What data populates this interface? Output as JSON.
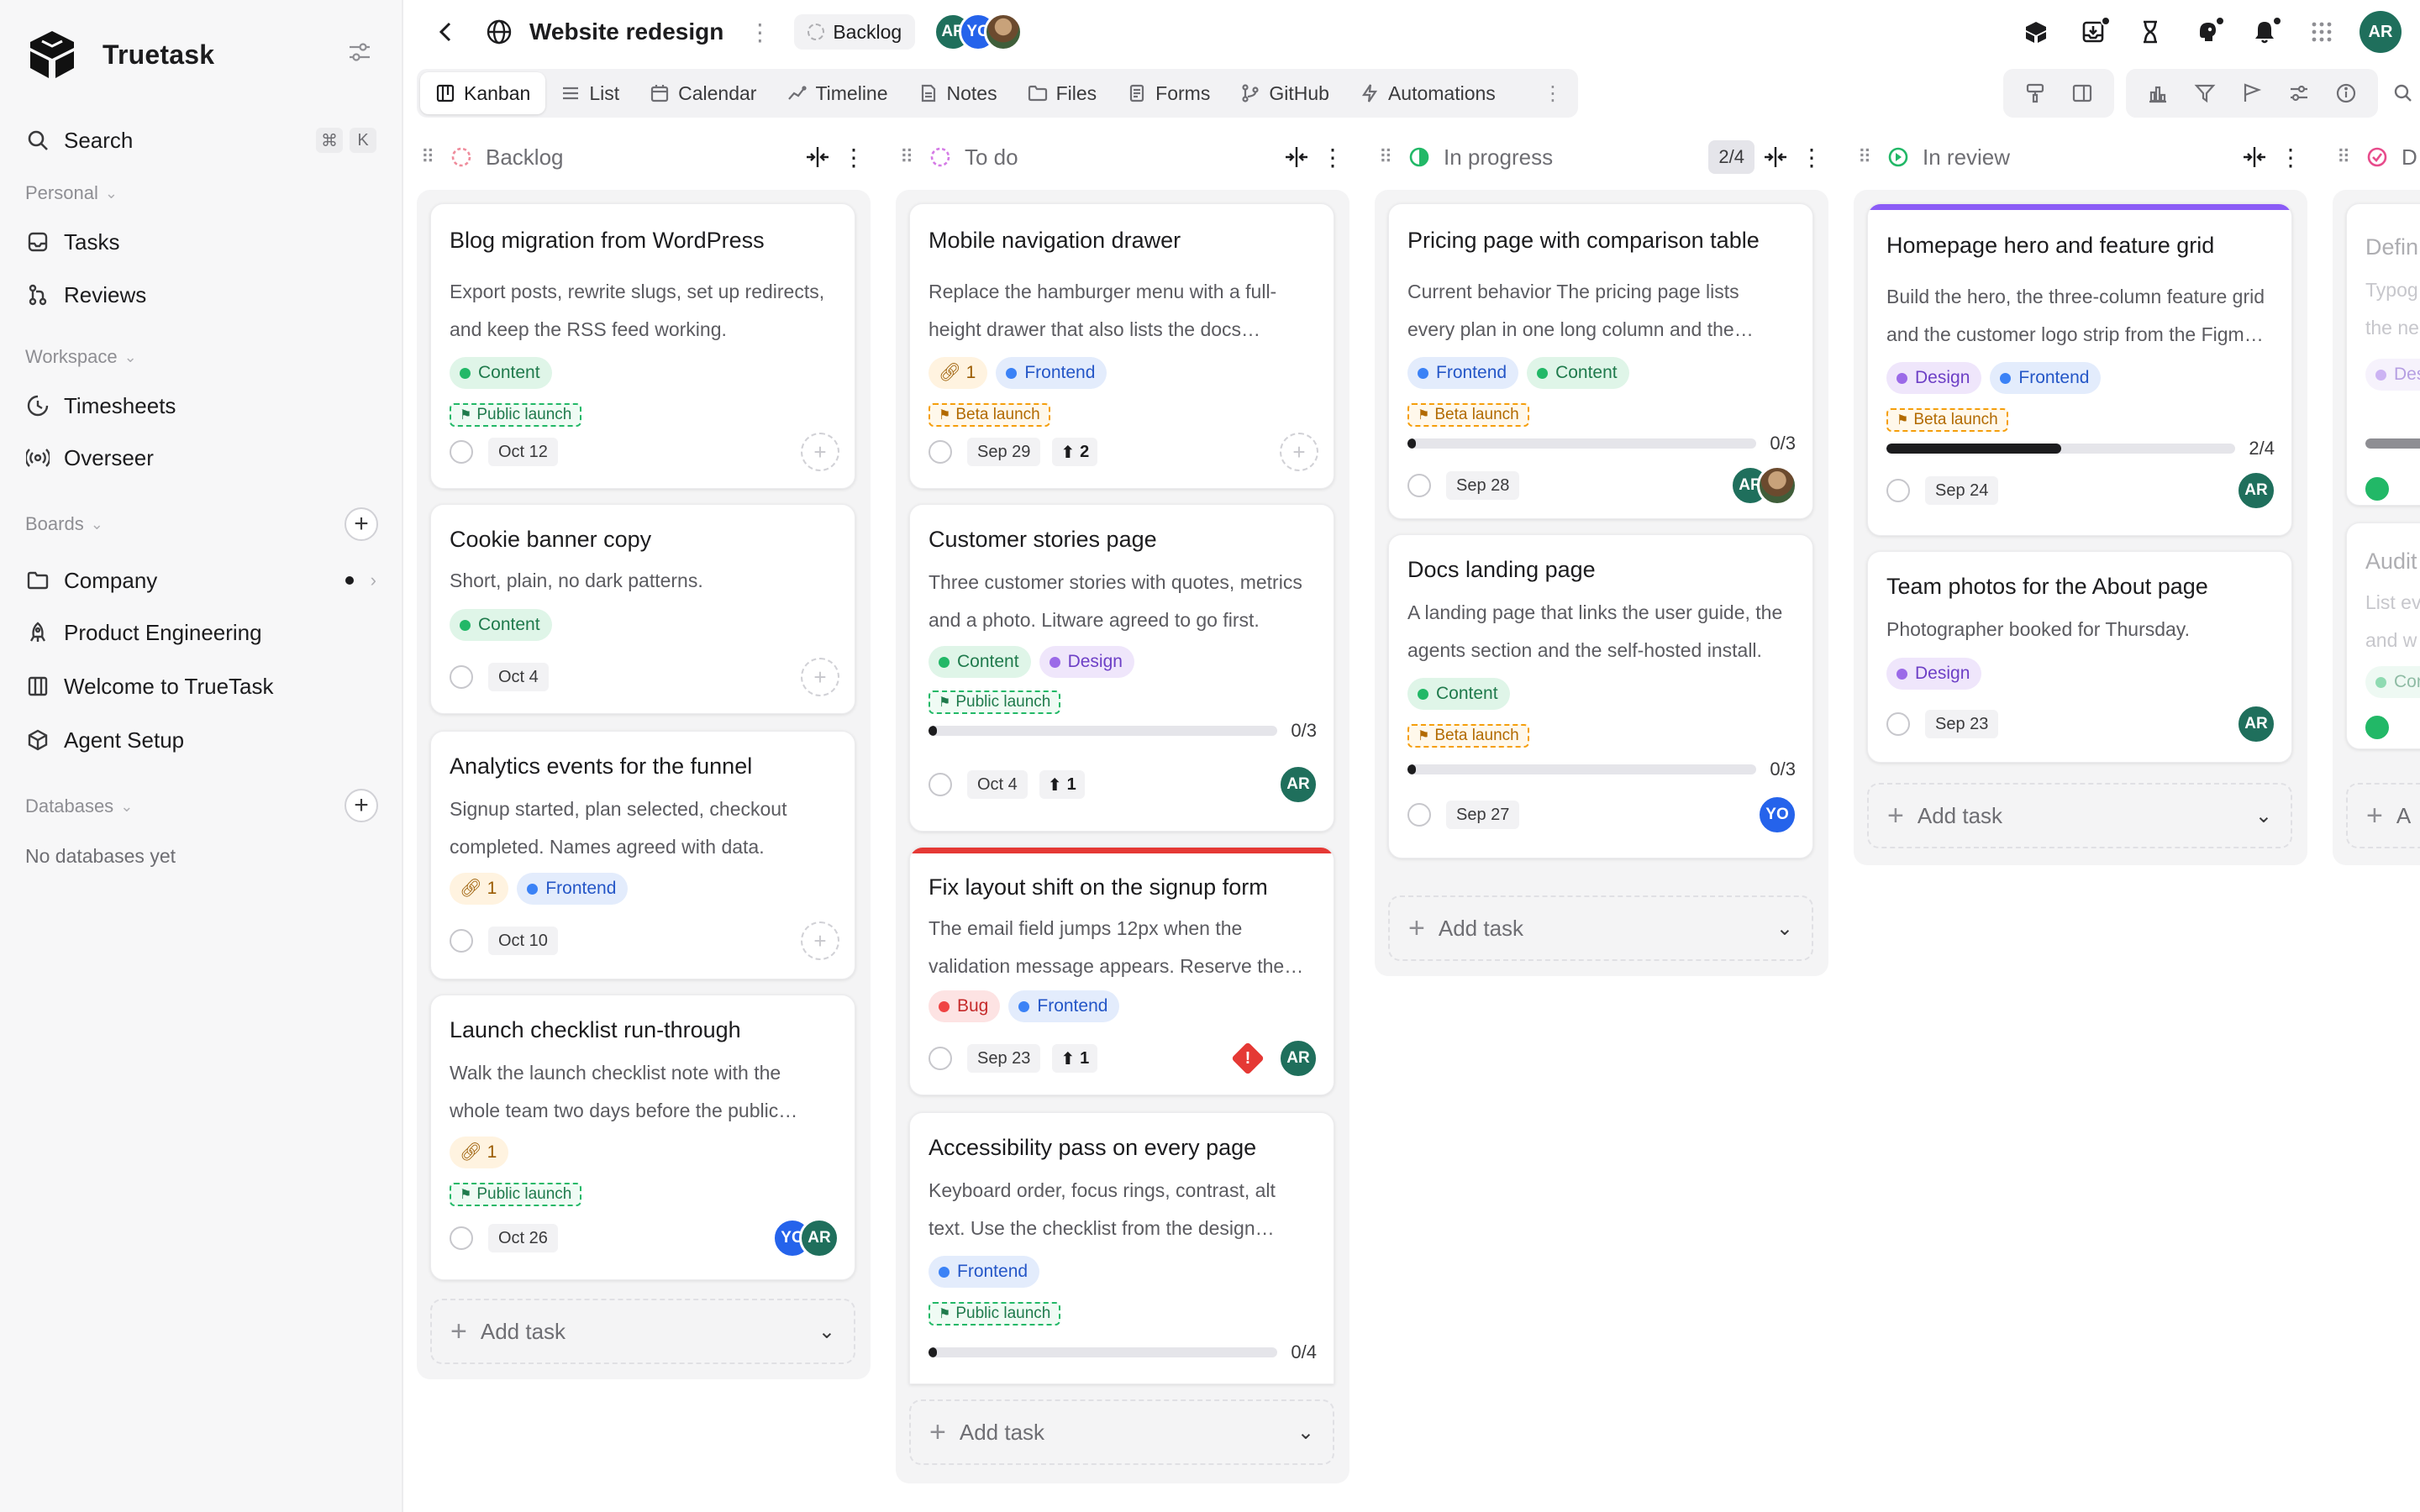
{
  "app": {
    "name": "Truetask"
  },
  "sidebar": {
    "search": {
      "label": "Search",
      "keys": [
        "⌘",
        "K"
      ]
    },
    "personal": {
      "label": "Personal",
      "items": [
        {
          "label": "Tasks"
        },
        {
          "label": "Reviews"
        }
      ]
    },
    "workspace": {
      "label": "Workspace",
      "items": [
        {
          "label": "Timesheets"
        },
        {
          "label": "Overseer"
        }
      ]
    },
    "boards": {
      "label": "Boards",
      "items": [
        {
          "label": "Company"
        },
        {
          "label": "Product Engineering"
        },
        {
          "label": "Welcome to TrueTask"
        },
        {
          "label": "Agent Setup"
        }
      ]
    },
    "databases": {
      "label": "Databases",
      "empty": "No databases yet"
    }
  },
  "header": {
    "title": "Website redesign",
    "status": "Backlog",
    "members": [
      "AR",
      "YO"
    ],
    "user_initials": "AR"
  },
  "tabs": [
    {
      "label": "Kanban",
      "active": true
    },
    {
      "label": "List"
    },
    {
      "label": "Calendar"
    },
    {
      "label": "Timeline"
    },
    {
      "label": "Notes"
    },
    {
      "label": "Files"
    },
    {
      "label": "Forms"
    },
    {
      "label": "GitHub"
    },
    {
      "label": "Automations"
    }
  ],
  "columns": [
    {
      "name": "Backlog",
      "add_label": "Add task",
      "cards": [
        {
          "title": "Blog migration from WordPress",
          "desc": "Export posts, rewrite slugs, set up redirects, and keep the RSS feed working.",
          "tags": [
            "Content"
          ],
          "milestone": "Public launch",
          "date": "Oct 12"
        },
        {
          "title": "Cookie banner copy",
          "desc": "Short, plain, no dark patterns.",
          "tags": [
            "Content"
          ],
          "date": "Oct 4"
        },
        {
          "title": "Analytics events for the funnel",
          "desc": "Signup started, plan selected, checkout completed. Names agreed with data.",
          "links": "1",
          "tags": [
            "Frontend"
          ],
          "date": "Oct 10"
        },
        {
          "title": "Launch checklist run-through",
          "desc": "Walk the launch checklist note with the whole team two days before the public launch.",
          "links": "1",
          "milestone": "Public launch",
          "date": "Oct 26",
          "assignees": [
            "YO",
            "AR"
          ]
        }
      ]
    },
    {
      "name": "To do",
      "add_label": "Add task",
      "cards": [
        {
          "title": "Mobile navigation drawer",
          "desc": "Replace the hamburger menu with a full-height drawer that also lists the docs sections.",
          "links": "1",
          "tags": [
            "Frontend"
          ],
          "milestone": "Beta launch",
          "date": "Sep 29",
          "priority": "2"
        },
        {
          "title": "Customer stories page",
          "desc": "Three customer stories with quotes, metrics and a photo. Litware agreed to go first.",
          "tags": [
            "Content",
            "Design"
          ],
          "milestone": "Public launch",
          "progress": "0/3",
          "progress_fraction": 0.0,
          "date": "Oct 4",
          "priority": "1",
          "assignees": [
            "AR"
          ]
        },
        {
          "title": "Fix layout shift on the signup form",
          "desc": "The email field jumps 12px when the validation message appears. Reserve the space.",
          "tags": [
            "Bug",
            "Frontend"
          ],
          "date": "Sep 23",
          "priority": "1",
          "urgent": "!",
          "assignees": [
            "AR"
          ],
          "accent": "#e53935"
        },
        {
          "title": "Accessibility pass on every page",
          "desc": "Keyboard order, focus rings, contrast, alt text. Use the checklist from the design system.",
          "tags": [
            "Frontend"
          ],
          "milestone": "Public launch",
          "progress": "0/4",
          "progress_fraction": 0.0
        }
      ]
    },
    {
      "name": "In progress",
      "count": "2/4",
      "add_label": "Add task",
      "cards": [
        {
          "title": "Pricing page with comparison table",
          "desc": "Current behavior The pricing page lists every plan in one long column and the comparison is hard to read.",
          "tags": [
            "Frontend",
            "Content"
          ],
          "milestone": "Beta launch",
          "progress": "0/3",
          "progress_fraction": 0.0,
          "date": "Sep 28",
          "assignees": [
            "AR",
            "photo"
          ]
        },
        {
          "title": "Docs landing page",
          "desc": "A landing page that links the user guide, the agents section and the self-hosted install.",
          "tags": [
            "Content"
          ],
          "milestone": "Beta launch",
          "progress": "0/3",
          "progress_fraction": 0.0,
          "date": "Sep 27",
          "assignees": [
            "YO"
          ]
        }
      ]
    },
    {
      "name": "In review",
      "add_label": "Add task",
      "cards": [
        {
          "title": "Homepage hero and feature grid",
          "desc": "Build the hero, the three-column feature grid and the customer logo strip from the Figma file.",
          "tags": [
            "Design",
            "Frontend"
          ],
          "milestone": "Beta launch",
          "progress": "2/4",
          "progress_fraction": 0.5,
          "date": "Sep 24",
          "assignees": [
            "AR"
          ],
          "accent": "#8b5cf6"
        },
        {
          "title": "Team photos for the About page",
          "desc": "Photographer booked for Thursday.",
          "tags": [
            "Design"
          ],
          "date": "Sep 23",
          "assignees": [
            "AR"
          ]
        }
      ]
    },
    {
      "name": "D",
      "partial": true,
      "cards": [
        {
          "title": "Defin",
          "desc": "Typog the ne",
          "tags": [
            "Des"
          ]
        },
        {
          "title": "Audit",
          "desc": "List ev and w",
          "tags": [
            "Con"
          ]
        }
      ],
      "add_label": "A"
    }
  ],
  "colors": {
    "accent_red": "#e53935",
    "accent_purple": "#8b5cf6",
    "avatar_ar": "#1f6f5c",
    "avatar_yo": "#2563eb"
  }
}
